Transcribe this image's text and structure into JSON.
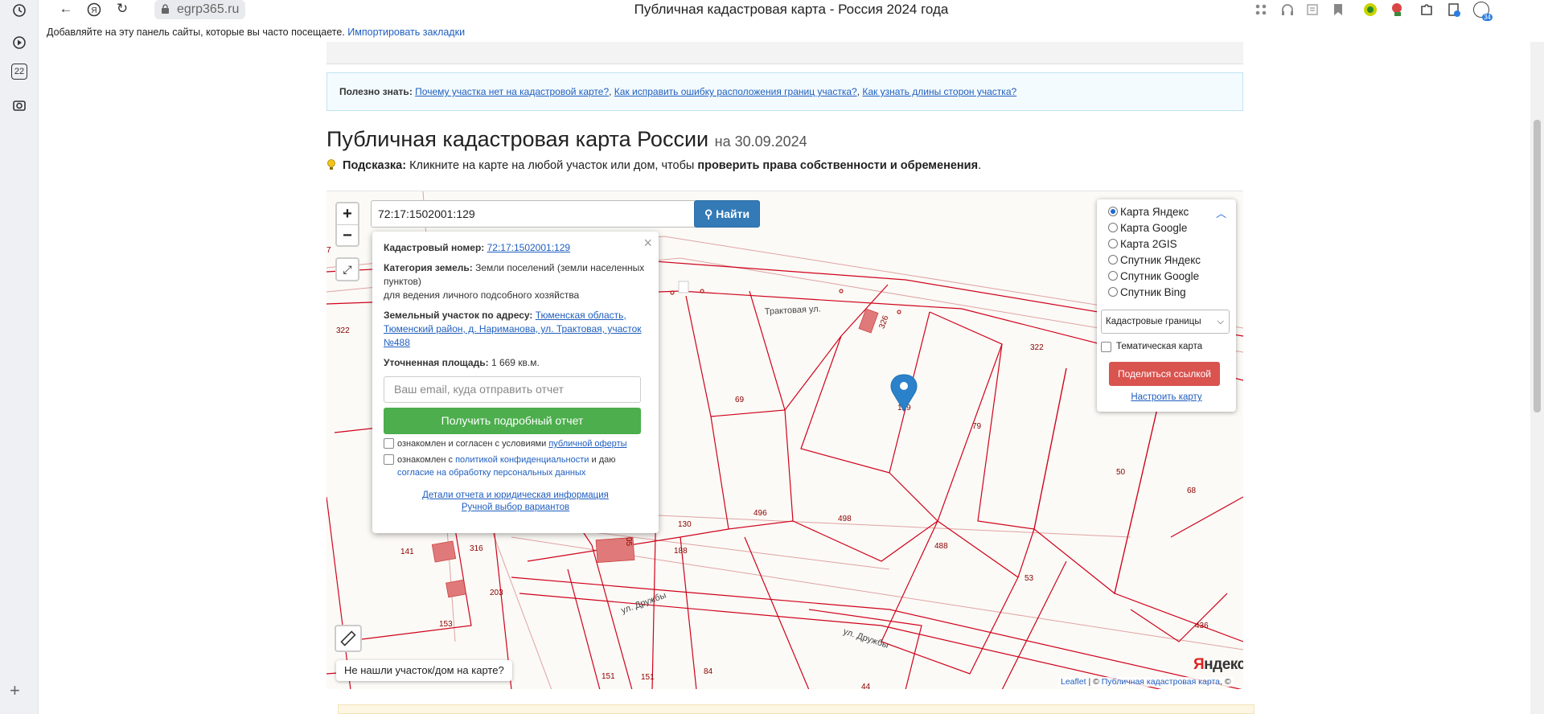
{
  "browser": {
    "url": "egrp365.ru",
    "title": "Публичная кадастровая карта - Россия 2024 года",
    "bookmarks_text": "Добавляйте на эту панель сайты, которые вы часто посещаете.",
    "bookmarks_link": "Импортировать закладки",
    "rail_badge": "22",
    "profile_badge": "34"
  },
  "info": {
    "prefix": "Полезно знать:",
    "link1": "Почему участка нет на кадастровой карте?",
    "link2": "Как исправить ошибку расположения границ участка?",
    "link3": "Как узнать длины сторон участка?",
    "sep": ", "
  },
  "heading": {
    "title": "Публичная кадастровая карта России",
    "date": "на 30.09.2024"
  },
  "hint": {
    "label": "Подсказка:",
    "text": "Кликните на карте на любой участок или дом, чтобы",
    "bold": "проверить права собственности и обременения",
    "end": "."
  },
  "map": {
    "zoom_in": "+",
    "zoom_out": "−",
    "search_value": "72:17:1502001:129",
    "search_button": "Найти",
    "not_found": "Не нашли участок/дом на карте?",
    "yandex_logo_y": "Я",
    "yandex_logo_rest": "ндекс",
    "attribution_leaflet": "Leaflet",
    "attribution_sep": " | © ",
    "attribution_source": "Публичная кадастровая карта",
    "attribution_end": ", ©",
    "street_labels": [
      "Трактовая ул.",
      "ул. Дружбы",
      "ул. Дружбы"
    ],
    "parcel_labels": [
      "322",
      "322",
      "69",
      "129",
      "79",
      "50",
      "68",
      "496",
      "498",
      "130",
      "488",
      "53",
      "141",
      "316",
      "188",
      "203",
      "153",
      "151",
      "151",
      "84",
      "44",
      "436",
      "326",
      "7",
      "05"
    ]
  },
  "popup": {
    "close": "×",
    "cad_label": "Кадастровый номер:",
    "cad_value": "72:17:1502001:129",
    "cat_label": "Категория земель:",
    "cat_value": "Земли поселений (земли населенных пунктов)",
    "cat_use": "для ведения личного подсобного хозяйства",
    "addr_label": "Земельный участок по адресу:",
    "addr_value": "Тюменская область, Тюменский район, д. Нариманова, ул. Трактовая, участок №488",
    "area_label": "Уточненная площадь:",
    "area_value": "1 669 кв.м.",
    "email_placeholder": "Ваш email, куда отправить отчет",
    "report_button": "Получить подробный отчет",
    "consent1_a": "ознакомлен и согласен с условиями",
    "consent1_link": "публичной оферты",
    "consent2_a": "ознакомлен с",
    "consent2_link": "политикой конфиденциальности",
    "consent2_b": "и даю",
    "consent2_link2": "согласие на обработку персональных данных",
    "details_link": "Детали отчета и юридическая информация",
    "manual_link": "Ручной выбор вариантов"
  },
  "layers": {
    "options": [
      "Карта Яндекс",
      "Карта Google",
      "Карта 2GIS",
      "Спутник Яндекс",
      "Спутник Google",
      "Спутник Bing"
    ],
    "selected": 0,
    "boundary_select": "Кадастровые границы",
    "thematic": "Тематическая карта",
    "share_button": "Поделиться ссылкой",
    "setup_link": "Настроить карту"
  },
  "colors": {
    "parcel_line": "#d0021b",
    "building": "#e07a7a",
    "accent": "#1a66d9"
  }
}
